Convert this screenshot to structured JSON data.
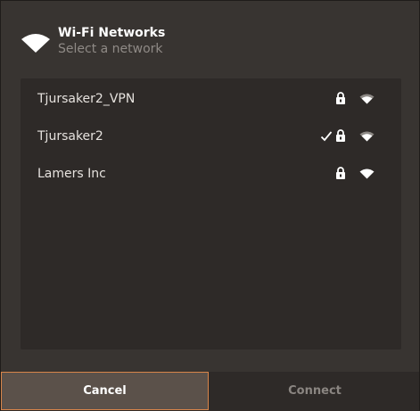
{
  "dialog": {
    "title": "Wi-Fi Networks",
    "subtitle": "Select a network",
    "header_icon": "wifi-icon"
  },
  "networks": [
    {
      "name": "Tjursaker2_VPN",
      "secured": true,
      "connected": false,
      "signal": "strong"
    },
    {
      "name": "Tjursaker2",
      "secured": true,
      "connected": true,
      "signal": "strong"
    },
    {
      "name": "Lamers Inc",
      "secured": true,
      "connected": false,
      "signal": "strong"
    }
  ],
  "icons": {
    "connected": "check-icon",
    "secured": "lock-icon",
    "signal": "wifi-signal-icon"
  },
  "buttons": {
    "cancel_label": "Cancel",
    "connect_label": "Connect"
  },
  "colors": {
    "accent_border": "#d8854a",
    "background": "#383431",
    "panel": "#2e2a28"
  }
}
